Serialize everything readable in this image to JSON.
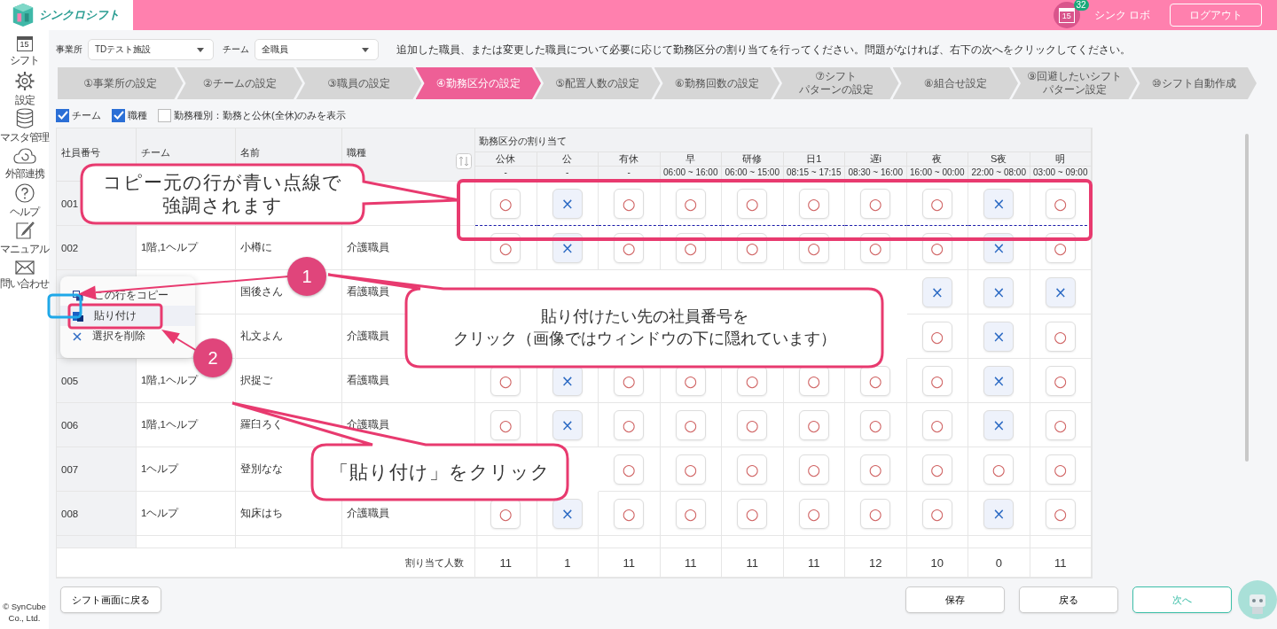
{
  "header": {
    "app_name": "シンクロシフト",
    "calendar_day": "15",
    "notification_count": "32",
    "user_name": "シンク ロボ",
    "logout_button": "ログアウト"
  },
  "sidebar": {
    "items": [
      {
        "label": "シフト",
        "day": "15"
      },
      {
        "label": "設定"
      },
      {
        "label": "マスタ管理"
      },
      {
        "label": "外部連携"
      },
      {
        "label": "ヘルプ"
      },
      {
        "label": "マニュアル"
      },
      {
        "label": "問い合わせ"
      }
    ],
    "copyright": [
      "© SynCube",
      "Co., Ltd."
    ]
  },
  "filters": {
    "office": {
      "label": "事業所",
      "value": "TDテスト施設"
    },
    "team": {
      "label": "チーム",
      "value": "全職員"
    },
    "instruction": "追加した職員、または変更した職員について必要に応じて勤務区分の割り当てを行ってください。問題がなければ、右下の次へをクリックしてください。"
  },
  "steps": [
    {
      "lines": [
        "①事業所の設定"
      ],
      "selected": false
    },
    {
      "lines": [
        "②チームの設定"
      ],
      "selected": false
    },
    {
      "lines": [
        "③職員の設定"
      ],
      "selected": false
    },
    {
      "lines": [
        "④勤務区分の設定"
      ],
      "selected": true
    },
    {
      "lines": [
        "⑤配置人数の設定"
      ],
      "selected": false
    },
    {
      "lines": [
        "⑥勤務回数の設定"
      ],
      "selected": false
    },
    {
      "lines": [
        "⑦シフト",
        "パターンの設定"
      ],
      "selected": false
    },
    {
      "lines": [
        "⑧組合せ設定"
      ],
      "selected": false
    },
    {
      "lines": [
        "⑨回避したいシフト",
        "パターン設定"
      ],
      "selected": false
    },
    {
      "lines": [
        "⑩シフト自動作成"
      ],
      "selected": false
    }
  ],
  "checkboxes": [
    {
      "label": "チーム",
      "checked": true
    },
    {
      "label": "職種",
      "checked": true
    },
    {
      "label": "勤務種別：勤務と公休(全休)のみを表示",
      "checked": false
    }
  ],
  "table": {
    "columns": [
      "社員番号",
      "チーム",
      "名前",
      "職種"
    ],
    "group_heading": "勤務区分の割り当て",
    "shifts": [
      {
        "name": "公休",
        "time": "-"
      },
      {
        "name": "公",
        "time": "-"
      },
      {
        "name": "有休",
        "time": "-"
      },
      {
        "name": "早",
        "time": "06:00 ~ 16:00"
      },
      {
        "name": "研修",
        "time": "06:00 ~ 15:00"
      },
      {
        "name": "日1",
        "time": "08:15 ~ 17:15"
      },
      {
        "name": "遅i",
        "time": "08:30 ~ 16:00"
      },
      {
        "name": "夜",
        "time": "16:00 ~ 00:00"
      },
      {
        "name": "S夜",
        "time": "22:00 ~ 08:00"
      },
      {
        "name": "明",
        "time": "03:00 ~ 09:00"
      }
    ],
    "rows": [
      {
        "id": "001",
        "copy_source": true,
        "cells": [
          {
            "mark": "○",
            "kind": "circle"
          },
          {
            "mark": "×",
            "kind": "cross"
          },
          {
            "mark": "○",
            "kind": "circle"
          },
          {
            "mark": "○",
            "kind": "circle"
          },
          {
            "mark": "○",
            "kind": "circle"
          },
          {
            "mark": "○",
            "kind": "circle"
          },
          {
            "mark": "○",
            "kind": "circle"
          },
          {
            "mark": "○",
            "kind": "circle"
          },
          {
            "mark": "×",
            "kind": "cross"
          },
          {
            "mark": "○",
            "kind": "circle"
          }
        ]
      },
      {
        "id": "002",
        "team": "1階,1ヘルプ",
        "name": "小樽に",
        "job": "介護職員",
        "copy_source": false,
        "cells": [
          {
            "mark": "○",
            "kind": "circle"
          },
          {
            "mark": "×",
            "kind": "cross"
          },
          {
            "mark": "○",
            "kind": "circle"
          },
          {
            "mark": "○",
            "kind": "circle"
          },
          {
            "mark": "○",
            "kind": "circle"
          },
          {
            "mark": "○",
            "kind": "circle"
          },
          {
            "mark": "○",
            "kind": "circle"
          },
          {
            "mark": "○",
            "kind": "circle"
          },
          {
            "mark": "×",
            "kind": "cross"
          },
          {
            "mark": "○",
            "kind": "circle"
          }
        ]
      },
      {
        "name": "国後さん",
        "job": "看護職員",
        "copy_source": false,
        "cells": [
          "",
          "",
          "",
          "",
          "",
          "",
          "",
          {
            "mark": "×",
            "kind": "cross"
          },
          {
            "mark": "×",
            "kind": "cross"
          },
          {
            "mark": "×",
            "kind": "cross"
          }
        ]
      },
      {
        "name": "礼文よん",
        "job": "介護職員",
        "copy_source": false,
        "cells": [
          "",
          "",
          "",
          "",
          "",
          "",
          "",
          {
            "mark": "○",
            "kind": "circle"
          },
          {
            "mark": "×",
            "kind": "cross"
          },
          {
            "mark": "○",
            "kind": "circle"
          }
        ]
      },
      {
        "id": "005",
        "team": "1階,1ヘルプ",
        "name": "択捉ご",
        "job": "看護職員",
        "copy_source": false,
        "cells": [
          {
            "mark": "○",
            "kind": "circle"
          },
          {
            "mark": "×",
            "kind": "cross"
          },
          {
            "mark": "○",
            "kind": "circle"
          },
          {
            "mark": "○",
            "kind": "circle"
          },
          {
            "mark": "○",
            "kind": "circle"
          },
          {
            "mark": "○",
            "kind": "circle"
          },
          {
            "mark": "○",
            "kind": "circle"
          },
          {
            "mark": "○",
            "kind": "circle"
          },
          {
            "mark": "×",
            "kind": "cross"
          },
          {
            "mark": "○",
            "kind": "circle"
          }
        ]
      },
      {
        "id": "006",
        "team": "1階,1ヘルプ",
        "name": "羅臼ろく",
        "job": "介護職員",
        "copy_source": false,
        "cells": [
          {
            "mark": "○",
            "kind": "circle"
          },
          {
            "mark": "×",
            "kind": "cross"
          },
          {
            "mark": "○",
            "kind": "circle"
          },
          {
            "mark": "○",
            "kind": "circle"
          },
          {
            "mark": "○",
            "kind": "circle"
          },
          {
            "mark": "○",
            "kind": "circle"
          },
          {
            "mark": "○",
            "kind": "circle"
          },
          {
            "mark": "○",
            "kind": "circle"
          },
          {
            "mark": "×",
            "kind": "cross"
          },
          {
            "mark": "○",
            "kind": "circle"
          }
        ]
      },
      {
        "id": "007",
        "team": "1ヘルプ",
        "name": "登別なな",
        "copy_source": false,
        "cells": [
          "",
          "",
          {
            "mark": "○",
            "kind": "circle"
          },
          {
            "mark": "○",
            "kind": "circle"
          },
          {
            "mark": "○",
            "kind": "circle"
          },
          {
            "mark": "○",
            "kind": "circle"
          },
          {
            "mark": "○",
            "kind": "circle"
          },
          {
            "mark": "○",
            "kind": "circle"
          },
          {
            "mark": "○",
            "kind": "circle"
          },
          {
            "mark": "○",
            "kind": "circle"
          }
        ]
      },
      {
        "id": "008",
        "team": "1ヘルプ",
        "name": "知床はち",
        "job": "介護職員",
        "copy_source": false,
        "cells": [
          {
            "mark": "○",
            "kind": "circle"
          },
          {
            "mark": "×",
            "kind": "cross"
          },
          {
            "mark": "○",
            "kind": "circle"
          },
          {
            "mark": "○",
            "kind": "circle"
          },
          {
            "mark": "○",
            "kind": "circle"
          },
          {
            "mark": "○",
            "kind": "circle"
          },
          {
            "mark": "○",
            "kind": "circle"
          },
          {
            "mark": "○",
            "kind": "circle"
          },
          {
            "mark": "×",
            "kind": "cross"
          },
          {
            "mark": "○",
            "kind": "circle"
          }
        ]
      }
    ],
    "totals": {
      "label": "割り当て人数",
      "values": [
        "11",
        "1",
        "11",
        "11",
        "11",
        "11",
        "12",
        "10",
        "0",
        "11"
      ]
    }
  },
  "footer": {
    "back_to_shift": "シフト画面に戻る",
    "save": "保存",
    "back": "戻る",
    "next": "次へ"
  },
  "annotations": {
    "callouts": [
      {
        "lines": [
          "コピー元の行が青い点線で",
          "強調されます"
        ]
      },
      {
        "lines": [
          "貼り付けたい先の社員番号を",
          "クリック（画像ではウィンドウの下に隠れています）"
        ]
      },
      {
        "lines": [
          "「貼り付け」をクリック"
        ]
      }
    ],
    "step_badges": [
      "1",
      "2"
    ],
    "context_menu": [
      {
        "label": "この行をコピー",
        "highlighted": false
      },
      {
        "label": "貼り付け",
        "highlighted": true
      },
      {
        "label": "選択を削除",
        "highlighted": false
      }
    ]
  }
}
